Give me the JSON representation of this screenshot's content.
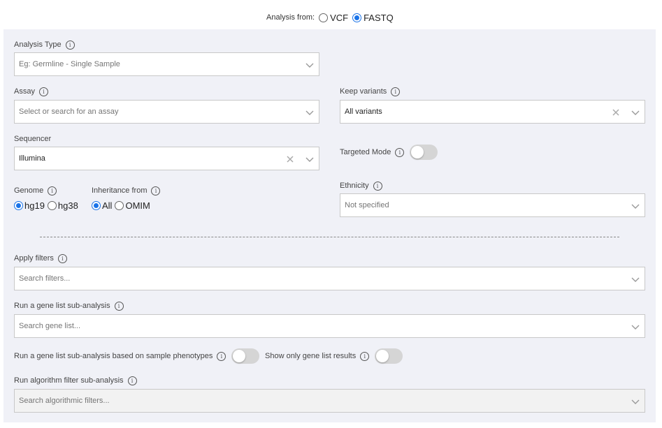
{
  "analysis_from": {
    "label": "Analysis from:",
    "options": [
      {
        "label": "VCF",
        "selected": false
      },
      {
        "label": "FASTQ",
        "selected": true
      }
    ]
  },
  "form": {
    "analysis_type": {
      "label": "Analysis Type",
      "placeholder": "Eg: Germline - Single Sample"
    },
    "assay": {
      "label": "Assay",
      "placeholder": "Select or search for an assay"
    },
    "keep_variants": {
      "label": "Keep variants",
      "value": "All variants"
    },
    "sequencer": {
      "label": "Sequencer",
      "value": "Illumina"
    },
    "targeted_mode": {
      "label": "Targeted Mode",
      "enabled": false
    },
    "genome": {
      "label": "Genome",
      "options": [
        {
          "label": "hg19",
          "selected": true
        },
        {
          "label": "hg38",
          "selected": false
        }
      ]
    },
    "inheritance": {
      "label": "Inheritance from",
      "options": [
        {
          "label": "All",
          "selected": true
        },
        {
          "label": "OMIM",
          "selected": false
        }
      ]
    },
    "ethnicity": {
      "label": "Ethnicity",
      "placeholder": "Not specified"
    },
    "apply_filters": {
      "label": "Apply filters",
      "placeholder": "Search filters..."
    },
    "gene_list": {
      "label": "Run a gene list sub-analysis",
      "placeholder": "Search gene list..."
    },
    "phenotype_sub": {
      "label": "Run a gene list sub-analysis based on sample phenotypes",
      "enabled": false
    },
    "gene_list_only": {
      "label": "Show only gene list results",
      "enabled": false
    },
    "algorithm": {
      "label": "Run algorithm filter sub-analysis",
      "placeholder": "Search algorithmic filters..."
    }
  },
  "icons": {
    "info": "info-icon",
    "chevron": "chevron-down-icon",
    "clear": "clear-icon"
  },
  "colors": {
    "accent": "#1a73e8",
    "panel": "#f0f1f7",
    "toggle_off": "#d5d5d5"
  }
}
